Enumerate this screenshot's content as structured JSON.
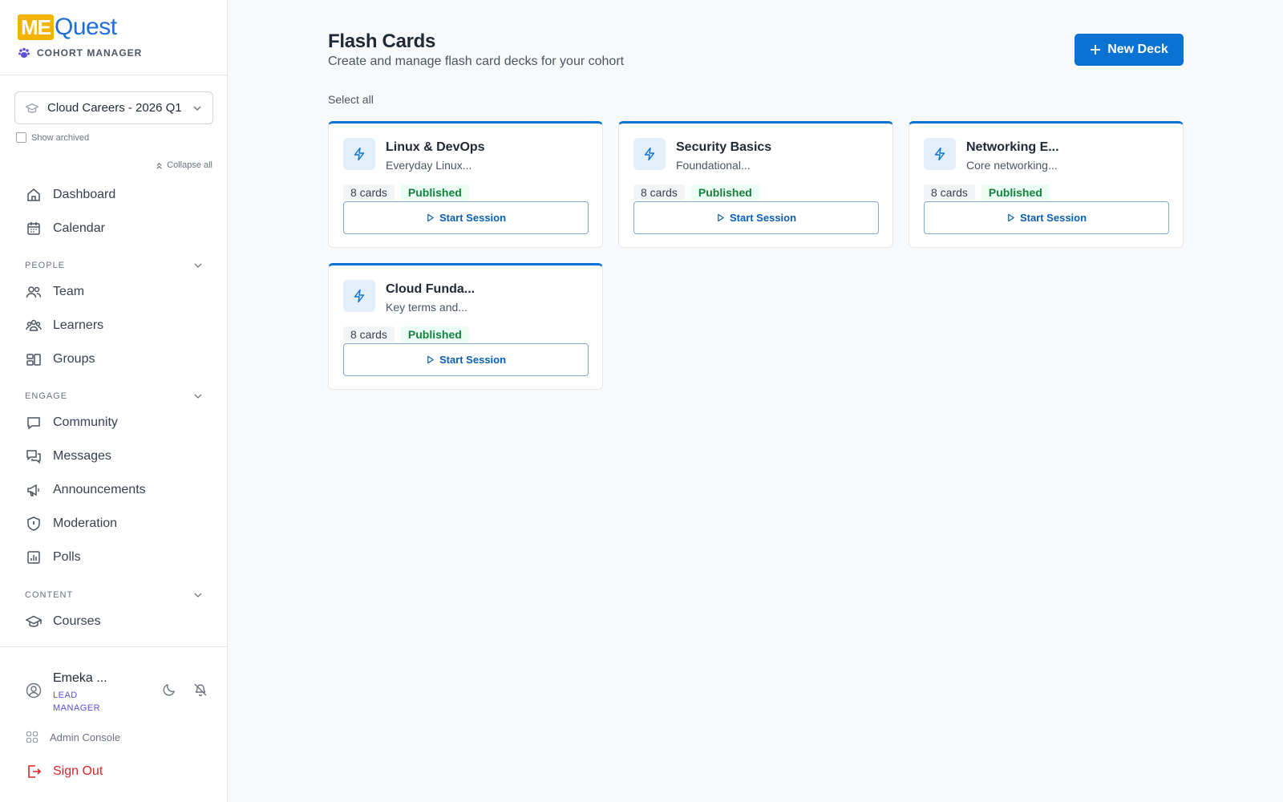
{
  "brand": {
    "logo_me": "ME",
    "logo_quest": "Quest",
    "subtitle": "COHORT MANAGER"
  },
  "cohort": {
    "selected": "Cloud Careers - 2026 Q1"
  },
  "show_archived_label": "Show archived",
  "collapse_all_label": "Collapse all",
  "nav": {
    "dashboard": "Dashboard",
    "calendar": "Calendar",
    "people_section": "PEOPLE",
    "team": "Team",
    "learners": "Learners",
    "groups": "Groups",
    "engage_section": "ENGAGE",
    "community": "Community",
    "messages": "Messages",
    "announcements": "Announcements",
    "moderation": "Moderation",
    "polls": "Polls",
    "content_section": "CONTENT",
    "courses": "Courses"
  },
  "user": {
    "name": "Emeka ...",
    "role": "LEAD MANAGER"
  },
  "admin_console_label": "Admin Console",
  "sign_out_label": "Sign Out",
  "page": {
    "title": "Flash Cards",
    "subtitle": "Create and manage flash card decks for your cohort",
    "new_deck_label": "New Deck",
    "select_all_label": "Select all"
  },
  "decks": [
    {
      "title": "Linux & DevOps",
      "description": "Everyday Linux...",
      "count": "8 cards",
      "status": "Published",
      "action": "Start Session"
    },
    {
      "title": "Security Basics",
      "description": "Foundational...",
      "count": "8 cards",
      "status": "Published",
      "action": "Start Session"
    },
    {
      "title": "Networking E...",
      "description": "Core networking...",
      "count": "8 cards",
      "status": "Published",
      "action": "Start Session"
    },
    {
      "title": "Cloud Funda...",
      "description": "Key terms and...",
      "count": "8 cards",
      "status": "Published",
      "action": "Start Session"
    }
  ],
  "colors": {
    "accent": "#0a72d0",
    "brand_yellow": "#f5b301",
    "danger": "#dc2626",
    "success": "#15803d"
  },
  "icons": {
    "dashboard": "home-icon",
    "calendar": "calendar-icon",
    "team": "users-icon",
    "learners": "user-group-icon",
    "groups": "layout-icon",
    "community": "chat-bubble-icon",
    "messages": "messages-icon",
    "announcements": "megaphone-icon",
    "moderation": "shield-icon",
    "polls": "bar-chart-icon",
    "courses": "graduation-cap-icon",
    "deck": "lightning-icon"
  }
}
